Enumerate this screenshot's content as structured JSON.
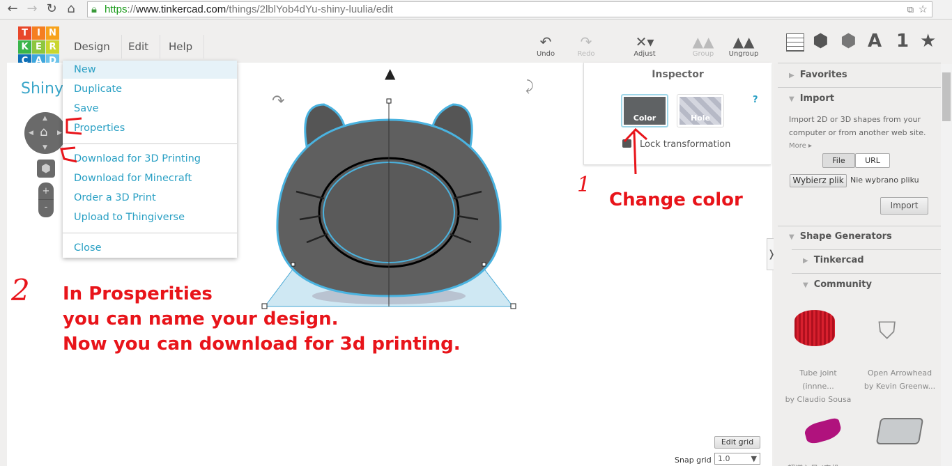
{
  "browser": {
    "url_scheme": "https",
    "url_sep": "://",
    "url_domain": "www.tinkercad.com",
    "url_path": "/things/2lblYob4dYu-shiny-luulia/edit"
  },
  "logo": {
    "letters": [
      "T",
      "I",
      "N",
      "K",
      "E",
      "R",
      "C",
      "A",
      "D"
    ],
    "colors": [
      "#e8472a",
      "#f57e20",
      "#f7a21b",
      "#3ab54a",
      "#8dc63f",
      "#c9d62e",
      "#0e6fb6",
      "#3ea6dc",
      "#6cc3ea"
    ]
  },
  "menu": {
    "design": "Design",
    "edit": "Edit",
    "help": "Help"
  },
  "toolbar": {
    "undo": "Undo",
    "redo": "Redo",
    "adjust": "Adjust",
    "group": "Group",
    "ungroup": "Ungroup"
  },
  "design_title": "Shiny",
  "dropdown": [
    "New",
    "Duplicate",
    "Save",
    "Properties",
    "Download for 3D Printing",
    "Download for Minecraft",
    "Order a 3D Print",
    "Upload to Thingiverse",
    "Close"
  ],
  "inspector": {
    "title": "Inspector",
    "color": "Color",
    "hole": "Hole",
    "help": "?",
    "lock": "Lock transformation"
  },
  "sidebar": {
    "icons": [
      "grid-icon",
      "box-icon",
      "striped-box-icon",
      "letter-a-icon",
      "number-1-icon",
      "star-icon"
    ],
    "icon_text": {
      "a": "A",
      "one": "1",
      "star": "★"
    },
    "favorites": "Favorites",
    "import": "Import",
    "import_desc1": "Import 2D or 3D shapes from your",
    "import_desc2": "computer or from another web site.",
    "more": "More ▸",
    "file": "File",
    "url": "URL",
    "choose_file": "Wybierz plik",
    "no_file": "Nie wybrano pliku",
    "import_btn": "Import",
    "shape_generators": "Shape Generators",
    "tinkercad": "Tinkercad",
    "community": "Community",
    "items": [
      {
        "title": "Tube joint (innne...",
        "author": "by Claudio Sousa"
      },
      {
        "title": "Open Arrowhead",
        "author": "by Kevin Greenw..."
      }
    ],
    "partial_label": "超道入日 (韦机"
  },
  "grid": {
    "edit_grid": "Edit grid",
    "snap_label": "Snap grid",
    "snap_value": "1.0"
  },
  "annotations": {
    "n1": "1",
    "n2": "2",
    "change_color": "Change color",
    "line1": "In Prosperities",
    "line2": "you can name your design.",
    "line3": "Now you can download for 3d printing."
  }
}
